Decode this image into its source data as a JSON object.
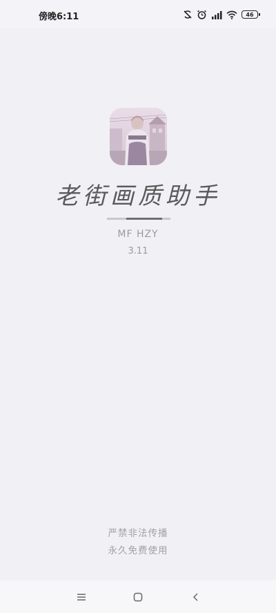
{
  "status_bar": {
    "time": "傍晚6:11",
    "battery": "46"
  },
  "app": {
    "title": "老街画质助手",
    "author": "MF HZY",
    "version": "3.11",
    "loading_progress": 0.57
  },
  "footer": {
    "line1": "严禁非法传播",
    "line2": "永久免费使用"
  },
  "icons": {
    "app_icon": "app-logo-illustration",
    "status": [
      "sync-off-icon",
      "alarm-icon",
      "cellular-signal-icon",
      "wifi-icon",
      "battery-icon"
    ],
    "nav": [
      "menu-icon",
      "home-icon",
      "back-icon"
    ]
  }
}
